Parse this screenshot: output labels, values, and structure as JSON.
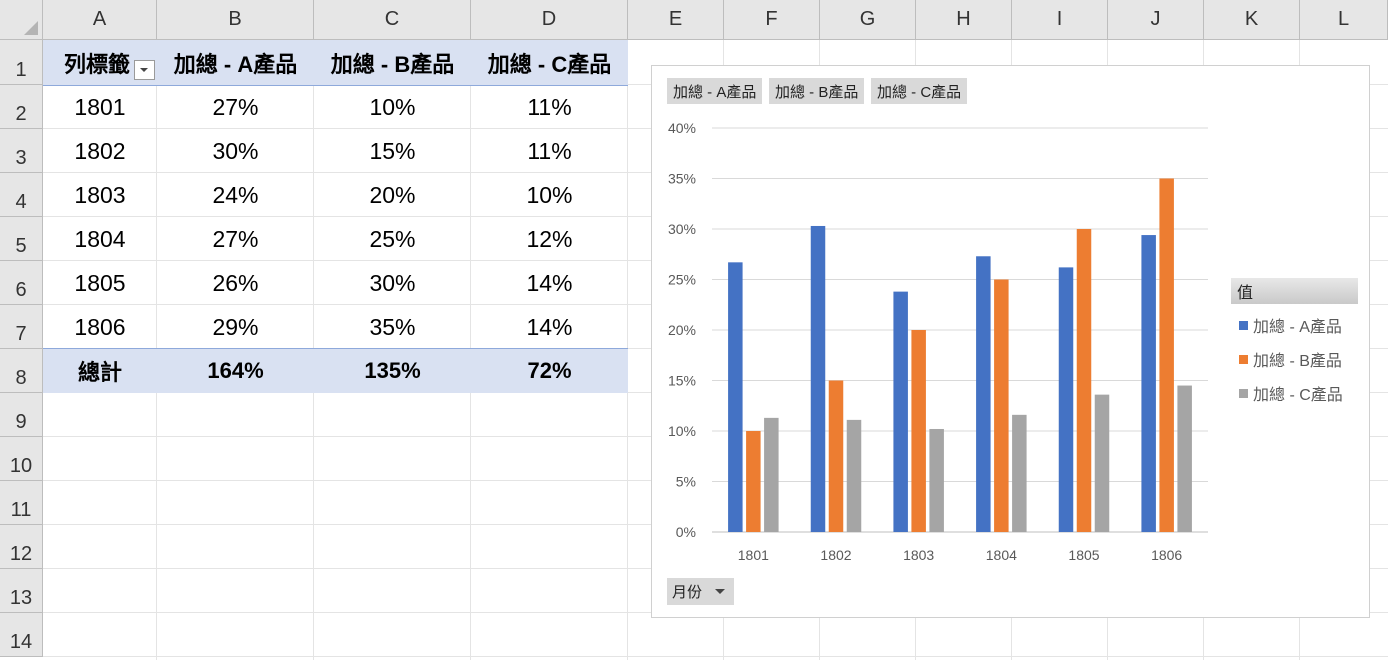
{
  "columns": [
    "A",
    "B",
    "C",
    "D",
    "E",
    "F",
    "G",
    "H",
    "I",
    "J",
    "K",
    "L"
  ],
  "rows": [
    "1",
    "2",
    "3",
    "4",
    "5",
    "6",
    "7",
    "8",
    "9",
    "10",
    "11",
    "12",
    "13",
    "14"
  ],
  "pivot": {
    "headers": [
      "列標籤",
      "加總 - A產品",
      "加總 - B產品",
      "加總 - C產品"
    ],
    "data": [
      [
        "1801",
        "27%",
        "10%",
        "11%"
      ],
      [
        "1802",
        "30%",
        "15%",
        "11%"
      ],
      [
        "1803",
        "24%",
        "20%",
        "10%"
      ],
      [
        "1804",
        "27%",
        "25%",
        "12%"
      ],
      [
        "1805",
        "26%",
        "30%",
        "14%"
      ],
      [
        "1806",
        "29%",
        "35%",
        "14%"
      ]
    ],
    "total": [
      "總計",
      "164%",
      "135%",
      "72%"
    ]
  },
  "chart": {
    "field_buttons": [
      "加總 - A產品",
      "加總 - B產品",
      "加總 - C產品"
    ],
    "legend_title": "值",
    "axis_field_button": "月份"
  },
  "colors": {
    "A": "#4472c4",
    "B": "#ed7d31",
    "C": "#a5a5a5",
    "band": "#d9e1f2"
  },
  "chart_data": {
    "type": "bar",
    "categories": [
      "1801",
      "1802",
      "1803",
      "1804",
      "1805",
      "1806"
    ],
    "series": [
      {
        "name": "加總 - A產品",
        "values": [
          26.7,
          30.3,
          23.8,
          27.3,
          26.2,
          29.4
        ]
      },
      {
        "name": "加總 - B產品",
        "values": [
          10,
          15,
          20,
          25,
          30,
          35
        ]
      },
      {
        "name": "加總 - C產品",
        "values": [
          11.3,
          11.1,
          10.2,
          11.6,
          13.6,
          14.5
        ]
      }
    ],
    "yticks": [
      "0%",
      "5%",
      "10%",
      "15%",
      "20%",
      "25%",
      "30%",
      "35%",
      "40%"
    ],
    "ylim": [
      0,
      40
    ],
    "grid": true,
    "legend": "right"
  }
}
